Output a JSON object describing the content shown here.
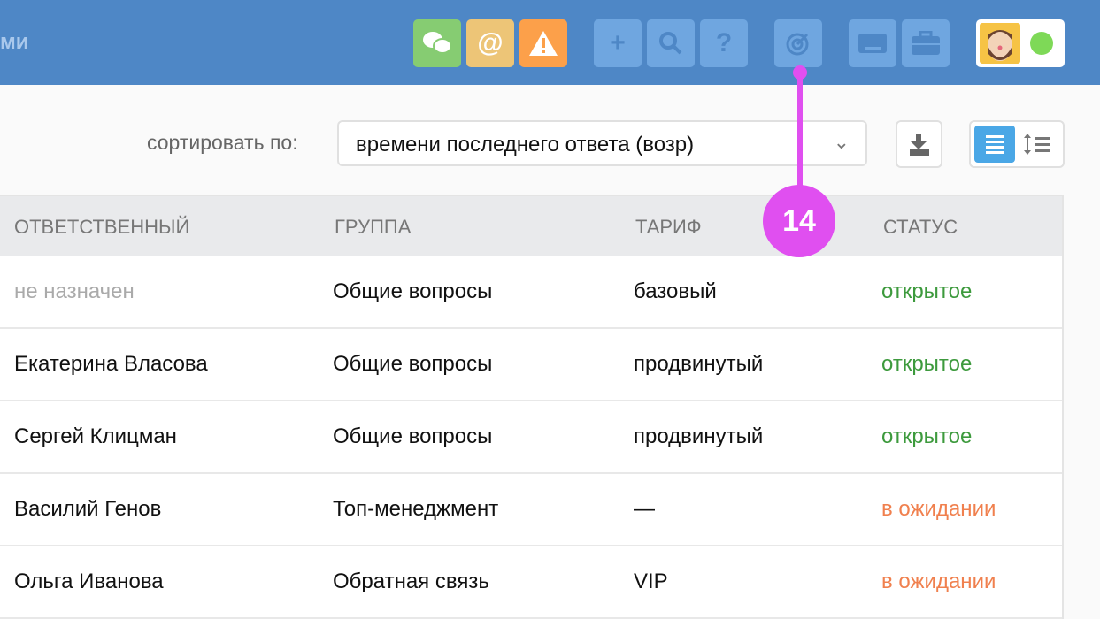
{
  "header": {
    "title_fragment": "ми",
    "buttons": [
      {
        "name": "chat",
        "color": "#86cc72"
      },
      {
        "name": "mention",
        "color": "#edc577",
        "label": "@"
      },
      {
        "name": "warning",
        "color": "#fca04a"
      },
      {
        "name": "add",
        "label": "+"
      },
      {
        "name": "search"
      },
      {
        "name": "help",
        "label": "?"
      },
      {
        "name": "target"
      },
      {
        "name": "keyboard"
      },
      {
        "name": "briefcase"
      }
    ],
    "status_color": "#7ed957"
  },
  "toolbar": {
    "sort_label": "сортировать по:",
    "sort_value": "времени последнего ответа (возр)",
    "active_view": "list"
  },
  "table": {
    "headers": [
      "ОТВЕТСТВЕННЫЙ",
      "ГРУППА",
      "ТАРИФ",
      "СТАТУС"
    ],
    "rows": [
      {
        "assignee": "не назначен",
        "group": "Общие вопросы",
        "tariff": "базовый",
        "status": "открытое"
      },
      {
        "assignee": "Екатерина Власова",
        "group": "Общие вопросы",
        "tariff": "продвинутый",
        "status": "открытое"
      },
      {
        "assignee": "Сергей Клицман",
        "group": "Общие вопросы",
        "tariff": "продвинутый",
        "status": "открытое"
      },
      {
        "assignee": "Василий Генов",
        "group": "Топ-менеджмент",
        "tariff": "—",
        "status": "в ожидании"
      },
      {
        "assignee": "Ольга Иванова",
        "group": "Обратная связь",
        "tariff": "VIP",
        "status": "в ожидании"
      }
    ]
  },
  "annotation": {
    "number": "14",
    "color": "#e04ff0"
  }
}
